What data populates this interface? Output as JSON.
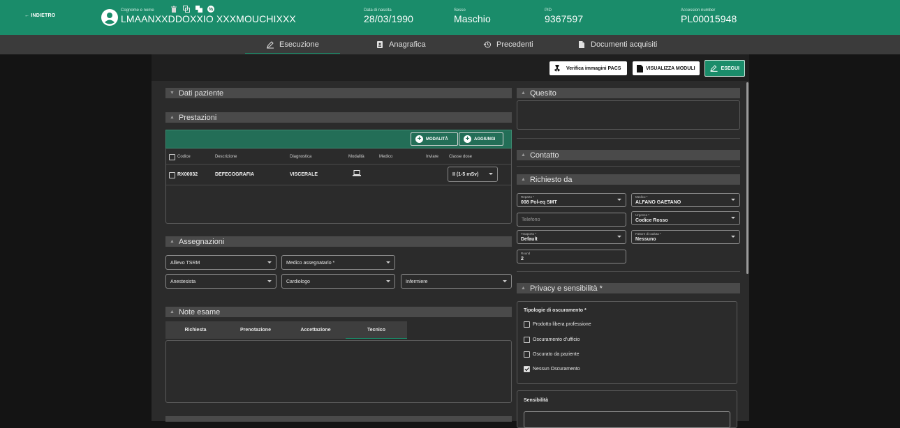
{
  "header": {
    "back_label": "← INDIETRO",
    "name_label": "Cognome e nome",
    "name_value": "LMAANXXDDOXXIO XXXMOUCHIXXX",
    "dob_label": "Data di nascita",
    "dob_value": "28/03/1990",
    "sex_label": "Sesso",
    "sex_value": "Maschio",
    "pid_label": "PID",
    "pid_value": "9367597",
    "acc_label": "Accession number",
    "acc_value": "PL00015948",
    "brand_color": "#1a8c6a"
  },
  "tabs": [
    {
      "label": "Esecuzione",
      "icon": "pencil-icon",
      "active": true
    },
    {
      "label": "Anagrafica",
      "icon": "id-card-icon"
    },
    {
      "label": "Precedenti",
      "icon": "history-icon"
    },
    {
      "label": "Documenti acquisiti",
      "icon": "document-icon"
    }
  ],
  "actions": {
    "pacs_label": "Verifica immagini PACS",
    "moduli_label": "VISUALIZZA MODULI",
    "esegui_label": "ESEGUI"
  },
  "sections": {
    "dati_paziente": "Dati paziente",
    "prestazioni": "Prestazioni",
    "assegnazioni": "Assegnazioni",
    "note_esame": "Note esame",
    "quesito": "Quesito",
    "contatto": "Contatto",
    "richiesto_da": "Richiesto da",
    "privacy": "Privacy e sensibilità *"
  },
  "prestazioni": {
    "modalita_btn": "MODALITÀ",
    "aggiungi_btn": "AGGIUNGI",
    "columns": [
      "Codice",
      "Descrizione",
      "Diagnostica",
      "Modalità",
      "Medico",
      "Inviare",
      "Classe dose"
    ],
    "row": {
      "codice": "RX00032",
      "descrizione": "DEFECOGRAFIA",
      "diagnostica": "VISCERALE",
      "classe_dose": "II (1-5 mSv)"
    }
  },
  "assegnazioni": {
    "allievo": "Allievo TSRM",
    "medico_assegnatario": "Medico assegnatario *",
    "anestesista": "Anestesista",
    "cardiologo": "Cardiologo",
    "infermiere": "Infermiere"
  },
  "note_tabs": [
    "Richiesta",
    "Prenotazione",
    "Accettazione",
    "Tecnico"
  ],
  "richiesto_da": {
    "reparto_label": "Reparto *",
    "reparto_value": "008 Pol-eq SMT",
    "medico_label": "Medico *",
    "medico_value": "ALFANO GAETANO",
    "telefono_placeholder": "Telefono",
    "urgenza_label": "Urgenza *",
    "urgenza_value": "Codice Rosso",
    "trasporto_label": "Trasporto *",
    "trasporto_value": "Default",
    "caduta_label": "Fattore di caduta *",
    "caduta_value": "Nessuno",
    "round_label": "Round",
    "round_value": "2"
  },
  "privacy": {
    "title": "Tipologie di oscuramento *",
    "items": [
      {
        "label": "Prodotto libera professione",
        "checked": false
      },
      {
        "label": "Oscuramento d'ufficio",
        "checked": false
      },
      {
        "label": "Oscurato da paziente",
        "checked": false
      },
      {
        "label": "Nessun Oscuramento",
        "checked": true
      }
    ],
    "sensibilita": "Sensibilità"
  }
}
